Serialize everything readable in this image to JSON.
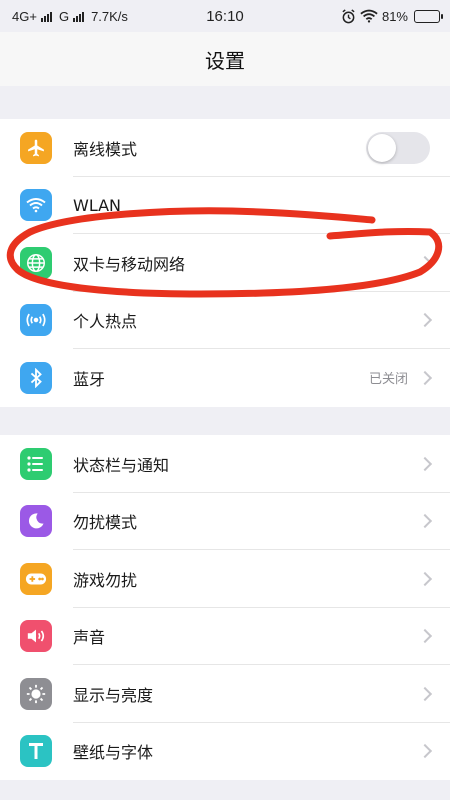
{
  "status_bar": {
    "network1": "4G+",
    "network2": "G",
    "speed": "7.7K/s",
    "time": "16:10",
    "battery": "81%",
    "battery_level": 0.81
  },
  "header": {
    "title": "设置"
  },
  "groups": [
    {
      "items": [
        {
          "label": "离线模式",
          "icon": "airplane-icon",
          "color": "#f5a623",
          "control": "toggle",
          "toggle_on": false
        },
        {
          "label": "WLAN",
          "icon": "wifi-icon",
          "color": "#3fa7f0",
          "control": "none"
        },
        {
          "label": "双卡与移动网络",
          "icon": "globe-icon",
          "color": "#2ecc71",
          "control": "chevron"
        },
        {
          "label": "个人热点",
          "icon": "hotspot-icon",
          "color": "#3fa7f0",
          "control": "chevron"
        },
        {
          "label": "蓝牙",
          "icon": "bluetooth-icon",
          "color": "#3fa7f0",
          "control": "chevron",
          "value": "已关闭"
        }
      ]
    },
    {
      "items": [
        {
          "label": "状态栏与通知",
          "icon": "notification-icon",
          "color": "#2ecc71",
          "control": "chevron"
        },
        {
          "label": "勿扰模式",
          "icon": "moon-icon",
          "color": "#9b59e6",
          "control": "chevron"
        },
        {
          "label": "游戏勿扰",
          "icon": "gamepad-icon",
          "color": "#f5a623",
          "control": "chevron"
        },
        {
          "label": "声音",
          "icon": "speaker-icon",
          "color": "#f0506e",
          "control": "chevron"
        },
        {
          "label": "显示与亮度",
          "icon": "brightness-icon",
          "color": "#8e8e93",
          "control": "chevron"
        },
        {
          "label": "壁纸与字体",
          "icon": "font-icon",
          "color": "#2bc3c3",
          "control": "chevron"
        }
      ]
    }
  ],
  "annotation_color": "#e8321e"
}
